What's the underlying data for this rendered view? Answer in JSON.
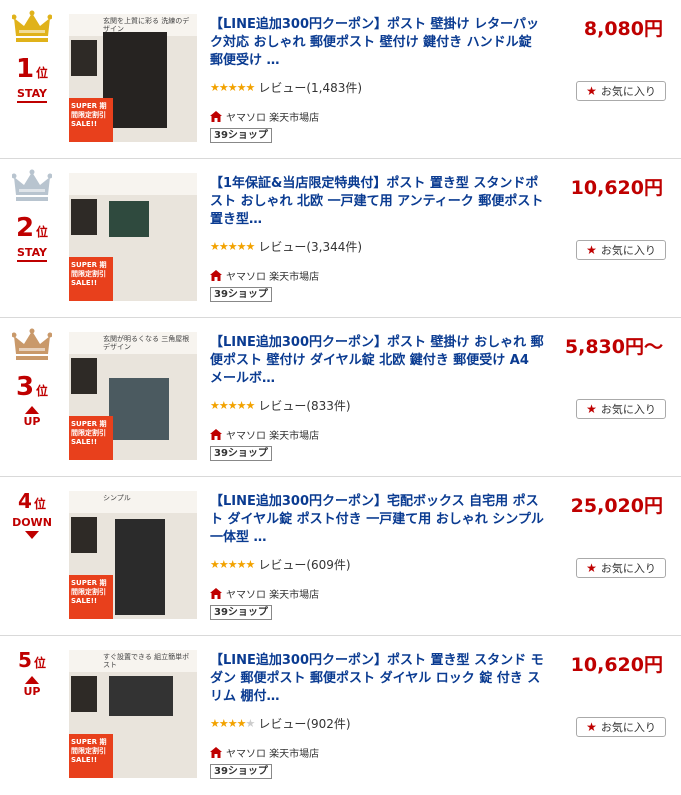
{
  "items": [
    {
      "rank": "1",
      "rank_unit": "位",
      "trend": "STAY",
      "trend_kind": "stay",
      "crown": "gold",
      "title": "【LINE追加300円クーポン】ポスト 壁掛け レターパック対応 おしゃれ 郵便ポスト 壁付け 鍵付き ハンドル錠 郵便受け …",
      "rating": 4.5,
      "review_label": "レビュー(1,483件)",
      "shop": "ヤマソロ 楽天市場店",
      "shipping": "39ショップ",
      "price": "8,080円",
      "fav_label": "お気に入り"
    },
    {
      "rank": "2",
      "rank_unit": "位",
      "trend": "STAY",
      "trend_kind": "stay",
      "crown": "silver",
      "title": "【1年保証&当店限定特典付】ポスト 置き型 スタンドポスト おしゃれ 北欧 一戸建て用 アンティーク 郵便ポスト 置き型…",
      "rating": 4.5,
      "review_label": "レビュー(3,344件)",
      "shop": "ヤマソロ 楽天市場店",
      "shipping": "39ショップ",
      "price": "10,620円",
      "fav_label": "お気に入り"
    },
    {
      "rank": "3",
      "rank_unit": "位",
      "trend": "UP",
      "trend_kind": "up",
      "crown": "bronze",
      "title": "【LINE追加300円クーポン】ポスト 壁掛け おしゃれ 郵便ポスト 壁付け ダイヤル錠 北欧 鍵付き 郵便受け A4 メールボ…",
      "rating": 4.5,
      "review_label": "レビュー(833件)",
      "shop": "ヤマソロ 楽天市場店",
      "shipping": "39ショップ",
      "price": "5,830円〜",
      "fav_label": "お気に入り"
    },
    {
      "rank": "4",
      "rank_unit": "位",
      "trend": "DOWN",
      "trend_kind": "down",
      "crown": "none",
      "title": "【LINE追加300円クーポン】宅配ボックス 自宅用 ポスト ダイヤル錠 ポスト付き 一戸建て用 おしゃれ シンプル 一体型 …",
      "rating": 4.5,
      "review_label": "レビュー(609件)",
      "shop": "ヤマソロ 楽天市場店",
      "shipping": "39ショップ",
      "price": "25,020円",
      "fav_label": "お気に入り"
    },
    {
      "rank": "5",
      "rank_unit": "位",
      "trend": "UP",
      "trend_kind": "up",
      "crown": "none",
      "title": "【LINE追加300円クーポン】ポスト 置き型 スタンド モダン 郵便ポスト 郵便ポスト ダイヤル ロック 錠 付き スリム 棚付…",
      "rating": 4.0,
      "review_label": "レビュー(902件)",
      "shop": "ヤマソロ 楽天市場店",
      "shipping": "39ショップ",
      "price": "10,620円",
      "fav_label": "お気に入り"
    }
  ],
  "thumbs": [
    {
      "band_text": "玄関を上質に彩る 洗練のデザイン",
      "product_color": "#262321",
      "sale_text": "SUPER 期間限定割引 SALE!!"
    },
    {
      "band_text": "",
      "product_color": "#2f4a3e",
      "sale_text": "SUPER 期間限定割引 SALE!!"
    },
    {
      "band_text": "玄関が明るくなる 三角屋根デザイン",
      "product_color": "#4b5a60",
      "sale_text": "SUPER 期間限定割引 SALE!!"
    },
    {
      "band_text": "シンプル",
      "product_color": "#2b2b2b",
      "sale_text": "SUPER 期間限定割引 SALE!!"
    },
    {
      "band_text": "すぐ設置できる 組立簡単ポスト",
      "product_color": "#333333",
      "sale_text": "SUPER 期間限定割引 SALE!!"
    }
  ],
  "colors": {
    "accent": "#bf0000",
    "title": "#0a3b91",
    "star": "#f2a200",
    "crown_gold": "#e0b21a",
    "crown_silver": "#b8c4cf",
    "crown_bronze": "#c9996a"
  },
  "icons": {
    "crown": "crown-icon",
    "shop": "house-icon",
    "favorite": "star-icon",
    "trend_up": "arrow-up-icon",
    "trend_down": "arrow-down-icon"
  }
}
